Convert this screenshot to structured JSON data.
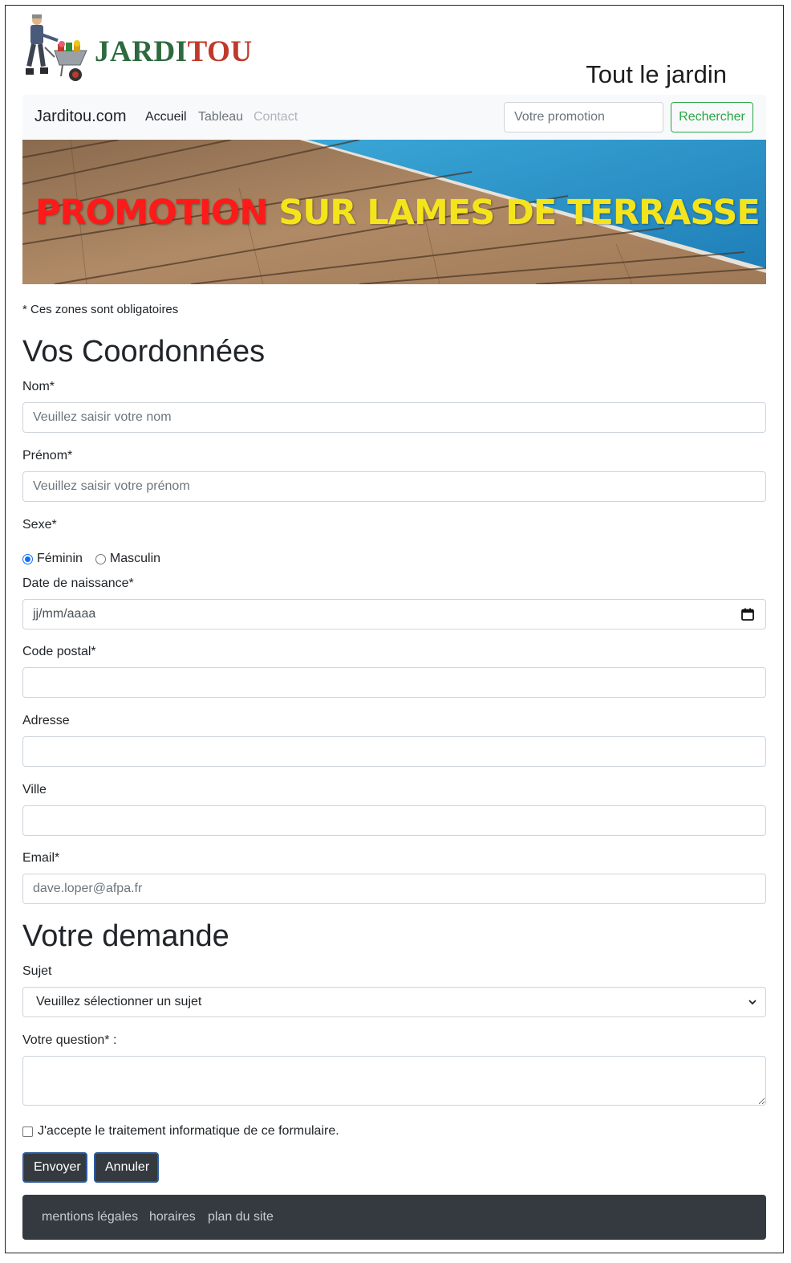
{
  "header": {
    "logo_text_part1": "JARDI",
    "logo_text_part2": "TOU",
    "tagline": "Tout le jardin"
  },
  "navbar": {
    "brand": "Jarditou.com",
    "links": [
      {
        "label": "Accueil",
        "state": "active"
      },
      {
        "label": "Tableau",
        "state": "normal"
      },
      {
        "label": "Contact",
        "state": "disabled"
      }
    ],
    "search_placeholder": "Votre promotion",
    "search_button": "Rechercher"
  },
  "banner": {
    "text_red": "PROMOTION",
    "text_yellow": "SUR LAMES DE TERRASSE"
  },
  "form": {
    "required_note": "* Ces zones sont obligatoires",
    "section1_title": "Vos Coordonnées",
    "nom_label": "Nom*",
    "nom_placeholder": "Veuillez saisir votre nom",
    "prenom_label": "Prénom*",
    "prenom_placeholder": "Veuillez saisir votre prénom",
    "sexe_label": "Sexe*",
    "sexe_options": [
      "Féminin",
      "Masculin"
    ],
    "sexe_selected": "Féminin",
    "date_label": "Date de naissance*",
    "date_placeholder": "jj/mm/aaaa",
    "cp_label": "Code postal*",
    "adresse_label": "Adresse",
    "ville_label": "Ville",
    "email_label": "Email*",
    "email_placeholder": "dave.loper@afpa.fr",
    "section2_title": "Votre demande",
    "sujet_label": "Sujet",
    "sujet_selected": "Veuillez sélectionner un sujet",
    "question_label": "Votre question* :",
    "consent_label": "J'accepte le traitement informatique de ce formulaire.",
    "submit_label": "Envoyer",
    "cancel_label": "Annuler"
  },
  "footer": {
    "links": [
      "mentions légales",
      "horaires",
      "plan du site"
    ]
  },
  "colors": {
    "logo_green": "#2d6a3d",
    "logo_red": "#c0392b",
    "navbar_bg": "#f8f9fa",
    "search_button": "#28a745",
    "banner_red": "#ff1a1a",
    "banner_yellow": "#f4e41c",
    "dark_button": "#343a40",
    "footer_bg": "#343a40"
  }
}
